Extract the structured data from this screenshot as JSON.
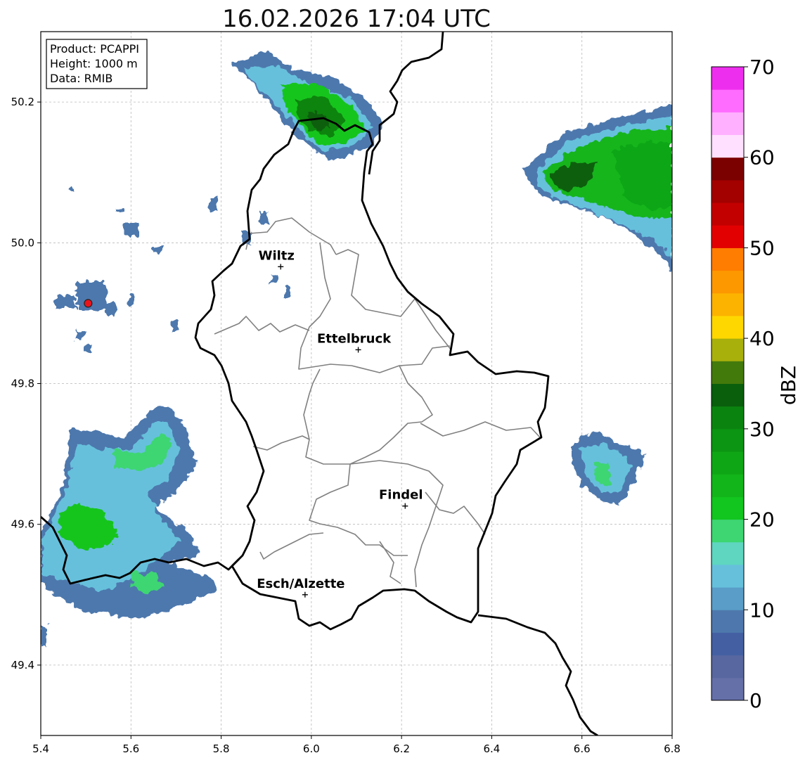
{
  "title": "16.02.2026 17:04 UTC",
  "info_box": {
    "product": "Product: PCAPPI",
    "height": "Height: 1000 m",
    "data": "Data: RMIB"
  },
  "map": {
    "lon_range": [
      5.4,
      6.8
    ],
    "lat_range": [
      49.3,
      50.3
    ],
    "x_ticks": [
      "5.4",
      "5.6",
      "5.8",
      "6.0",
      "6.2",
      "6.4",
      "6.6",
      "6.8"
    ],
    "y_ticks": [
      "49.4",
      "49.6",
      "49.8",
      "50.0",
      "50.2"
    ],
    "grid": true,
    "radar_site": {
      "lon": 5.505,
      "lat": 49.914,
      "marker_color": "#e8141c"
    },
    "cities": [
      {
        "name": "Wiltz",
        "lon": 5.932,
        "lat": 49.966
      },
      {
        "name": "Ettelbruck",
        "lon": 6.104,
        "lat": 49.848
      },
      {
        "name": "Findel",
        "lon": 6.208,
        "lat": 49.626
      },
      {
        "name": "Esch/Alzette",
        "lon": 5.986,
        "lat": 49.5
      }
    ]
  },
  "colorbar": {
    "label": "dBZ",
    "min": 0,
    "max": 70,
    "tick_labels": [
      "0",
      "10",
      "20",
      "30",
      "40",
      "50",
      "60",
      "70"
    ],
    "colors": [
      "#6570a8",
      "#58679f",
      "#4460a3",
      "#4e78ad",
      "#5a9dc8",
      "#66c0dc",
      "#5fd6c0",
      "#3dd672",
      "#12c51f",
      "#12b51a",
      "#0fa616",
      "#0c9512",
      "#0b840f",
      "#095f0c",
      "#437a0c",
      "#a8b00c",
      "#fed700",
      "#fcb300",
      "#fd9800",
      "#ff7d00",
      "#e30000",
      "#c30000",
      "#a30000",
      "#7b0000",
      "#ffe0ff",
      "#ffb0ff",
      "#ff6cff",
      "#ee2eee"
    ]
  },
  "colors": {
    "border_country": "#000000",
    "border_canton": "#808080"
  }
}
